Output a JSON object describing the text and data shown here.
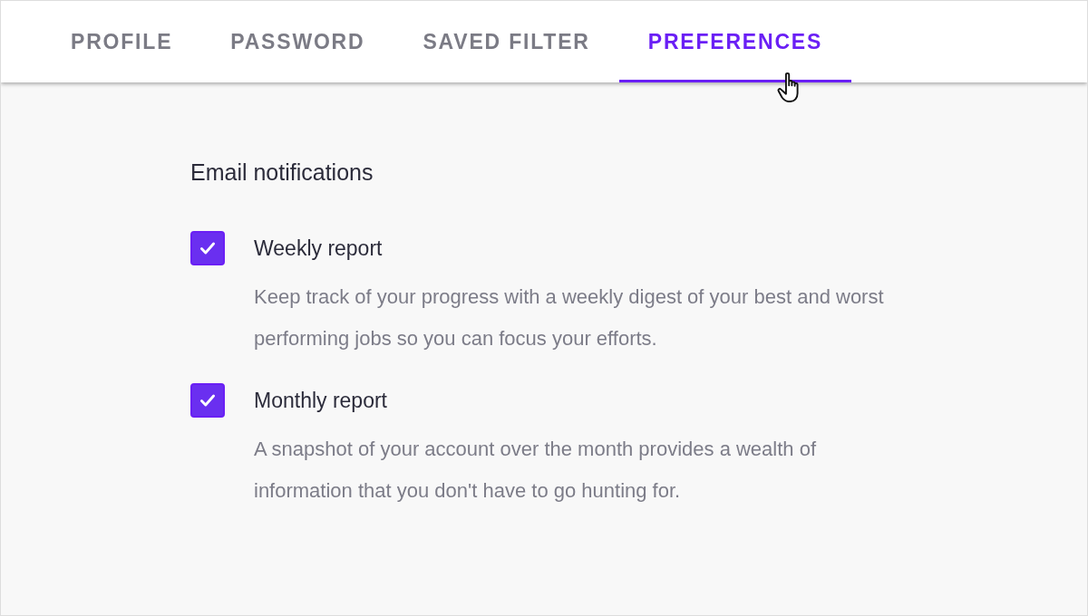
{
  "tabs": [
    {
      "label": "PROFILE",
      "selected": false
    },
    {
      "label": "PASSWORD",
      "selected": false
    },
    {
      "label": "SAVED FILTER",
      "selected": false
    },
    {
      "label": "PREFERENCES",
      "selected": true
    }
  ],
  "section": {
    "title": "Email notifications",
    "options": [
      {
        "label": "Weekly report",
        "checked": true,
        "description": "Keep track of your progress with a weekly digest of your best and worst performing jobs so you can focus your efforts."
      },
      {
        "label": "Monthly report",
        "checked": true,
        "description": "A snapshot of your account over the month provides a wealth of information that you don't have to go hunting for."
      }
    ]
  }
}
